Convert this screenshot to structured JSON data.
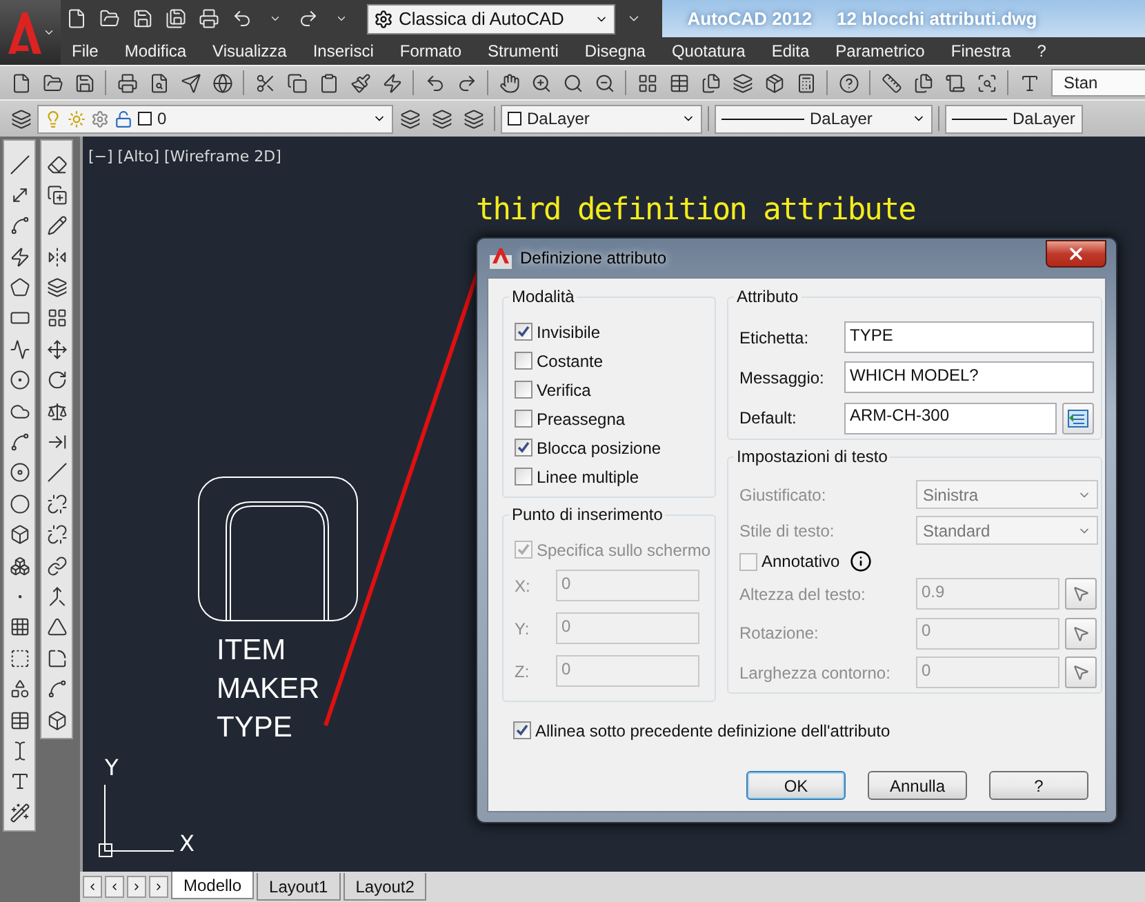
{
  "app": {
    "title": "AutoCAD 2012",
    "document": "12 blocchi attributi.dwg",
    "workspace": "Classica di AutoCAD"
  },
  "menu": [
    {
      "label": "File"
    },
    {
      "label": "Modifica"
    },
    {
      "label": "Visualizza"
    },
    {
      "label": "Inserisci"
    },
    {
      "label": "Formato"
    },
    {
      "label": "Strumenti"
    },
    {
      "label": "Disegna"
    },
    {
      "label": "Quotatura"
    },
    {
      "label": "Edita"
    },
    {
      "label": "Parametrico"
    },
    {
      "label": "Finestra"
    },
    {
      "label": "?"
    }
  ],
  "text_style": "Stan",
  "layer_bar": {
    "layer": "0",
    "color_setting": "DaLayer",
    "linetype": "DaLayer",
    "lineweight": "DaLayer"
  },
  "viewport_label": "[−] [Alto] [Wireframe 2D]",
  "annotation": "third definition attribute",
  "drawing_texts": [
    "ITEM",
    "MAKER",
    "TYPE"
  ],
  "axes": {
    "x": "X",
    "y": "Y"
  },
  "layout_tabs": [
    {
      "label": "Modello",
      "selected": true
    },
    {
      "label": "Layout1",
      "selected": false
    },
    {
      "label": "Layout2",
      "selected": false
    }
  ],
  "dialog": {
    "title": "Definizione attributo",
    "modes": {
      "title": "Modalità",
      "items": [
        {
          "label": "Invisibile",
          "checked": true
        },
        {
          "label": "Costante",
          "checked": false
        },
        {
          "label": "Verifica",
          "checked": false
        },
        {
          "label": "Preassegna",
          "checked": false
        },
        {
          "label": "Blocca posizione",
          "checked": true
        },
        {
          "label": "Linee multiple",
          "checked": false
        }
      ]
    },
    "insertion": {
      "title": "Punto di inserimento",
      "disabled": true,
      "on_screen": {
        "label": "Specifica sullo schermo",
        "checked": true
      },
      "coords": [
        {
          "label": "X:",
          "value": "0"
        },
        {
          "label": "Y:",
          "value": "0"
        },
        {
          "label": "Z:",
          "value": "0"
        }
      ]
    },
    "attribute": {
      "title": "Attributo",
      "fields": [
        {
          "label": "Etichetta:",
          "value": "TYPE",
          "kind": "text"
        },
        {
          "label": "Messaggio:",
          "value": "WHICH MODEL?",
          "kind": "text"
        },
        {
          "label": "Default:",
          "value": "ARM-CH-300",
          "kind": "field"
        }
      ]
    },
    "text_settings": {
      "title": "Impostazioni di testo",
      "disabled": true,
      "rows": [
        {
          "kind": "select",
          "label": "Giustificato:",
          "value": "Sinistra"
        },
        {
          "kind": "select",
          "label": "Stile di testo:",
          "value": "Standard"
        },
        {
          "kind": "checkbox",
          "label": "Annotativo",
          "checked": false
        },
        {
          "kind": "pick",
          "label": "Altezza del testo:",
          "value": "0.9"
        },
        {
          "kind": "pick",
          "label": "Rotazione:",
          "value": "0"
        },
        {
          "kind": "pick",
          "label": "Larghezza contorno:",
          "value": "0"
        }
      ]
    },
    "align": {
      "label": "Allinea sotto precedente definizione dell'attributo",
      "checked": true
    },
    "buttons": [
      {
        "label": "OK",
        "focused": true
      },
      {
        "label": "Annulla",
        "focused": false
      },
      {
        "label": "?",
        "focused": false
      }
    ]
  }
}
